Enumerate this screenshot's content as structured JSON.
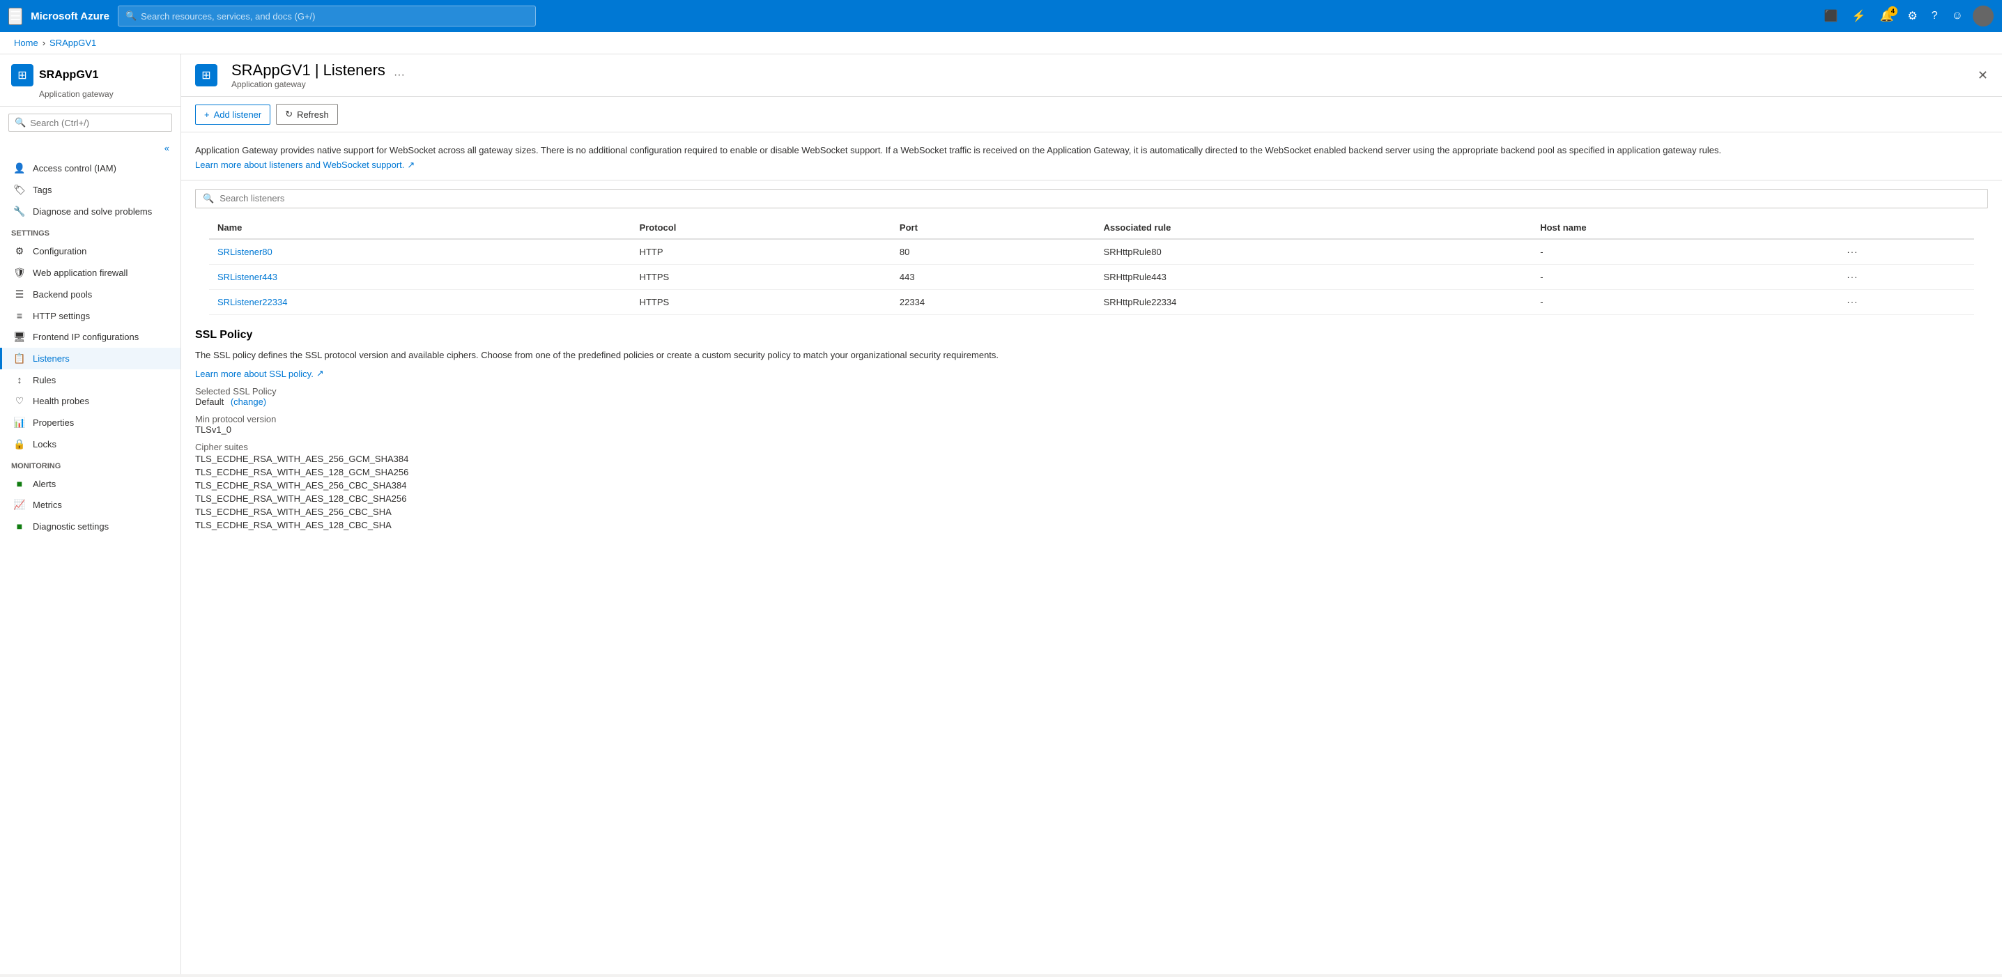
{
  "topbar": {
    "menu_label": "☰",
    "logo": "Microsoft Azure",
    "search_placeholder": "Search resources, services, and docs (G+/)",
    "notification_count": "4",
    "icons": {
      "email": "✉",
      "upload": "⬆",
      "bell": "🔔",
      "settings": "⚙",
      "help": "?",
      "feedback": "☺"
    }
  },
  "breadcrumb": {
    "home": "Home",
    "resource": "SRAppGV1"
  },
  "sidebar": {
    "resource_name": "SRAppGV1 | Listeners",
    "resource_type": "Application gateway",
    "search_placeholder": "Search (Ctrl+/)",
    "collapse_label": "«",
    "sections": {
      "settings_label": "Settings",
      "monitoring_label": "Monitoring"
    },
    "items": [
      {
        "id": "access-control",
        "label": "Access control (IAM)",
        "icon": "👤"
      },
      {
        "id": "tags",
        "label": "Tags",
        "icon": "🏷"
      },
      {
        "id": "diagnose",
        "label": "Diagnose and solve problems",
        "icon": "🔧"
      },
      {
        "id": "configuration",
        "label": "Configuration",
        "icon": "⚙"
      },
      {
        "id": "web-app-firewall",
        "label": "Web application firewall",
        "icon": "🛡"
      },
      {
        "id": "backend-pools",
        "label": "Backend pools",
        "icon": "☰"
      },
      {
        "id": "http-settings",
        "label": "HTTP settings",
        "icon": "≡"
      },
      {
        "id": "frontend-ip",
        "label": "Frontend IP configurations",
        "icon": "🖥"
      },
      {
        "id": "listeners",
        "label": "Listeners",
        "icon": "📋",
        "active": true
      },
      {
        "id": "rules",
        "label": "Rules",
        "icon": "↕"
      },
      {
        "id": "health-probes",
        "label": "Health probes",
        "icon": "♡"
      },
      {
        "id": "properties",
        "label": "Properties",
        "icon": "📊"
      },
      {
        "id": "locks",
        "label": "Locks",
        "icon": "🔒"
      },
      {
        "id": "alerts",
        "label": "Alerts",
        "icon": "🟩"
      },
      {
        "id": "metrics",
        "label": "Metrics",
        "icon": "📈"
      },
      {
        "id": "diagnostic-settings",
        "label": "Diagnostic settings",
        "icon": "🟩"
      }
    ]
  },
  "content": {
    "title": "SRAppGV1 | Listeners",
    "subtitle": "Application gateway",
    "toolbar": {
      "add_listener": "Add listener",
      "refresh": "Refresh"
    },
    "info_text": "Application Gateway provides native support for WebSocket across all gateway sizes. There is no additional configuration required to enable or disable WebSocket support. If a WebSocket traffic is received on the Application Gateway, it is automatically directed to the WebSocket enabled backend server using the appropriate backend pool as specified in application gateway rules.",
    "info_link": "Learn more about listeners and WebSocket support.",
    "search_placeholder": "Search listeners",
    "table": {
      "columns": [
        "Name",
        "Protocol",
        "Port",
        "Associated rule",
        "Host name"
      ],
      "rows": [
        {
          "name": "SRListener80",
          "protocol": "HTTP",
          "port": "80",
          "rule": "SRHttpRule80",
          "hostname": "-"
        },
        {
          "name": "SRListener443",
          "protocol": "HTTPS",
          "port": "443",
          "rule": "SRHttpRule443",
          "hostname": "-"
        },
        {
          "name": "SRListener22334",
          "protocol": "HTTPS",
          "port": "22334",
          "rule": "SRHttpRule22334",
          "hostname": "-"
        }
      ]
    },
    "ssl_policy": {
      "title": "SSL Policy",
      "description": "The SSL policy defines the SSL protocol version and available ciphers. Choose from one of the predefined policies or create a custom security policy to match your organizational security requirements.",
      "learn_more_link": "Learn more about SSL policy.",
      "selected_label": "Selected SSL Policy",
      "selected_value": "Default",
      "change_label": "(change)",
      "min_protocol_label": "Min protocol version",
      "min_protocol_value": "TLSv1_0",
      "cipher_label": "Cipher suites",
      "ciphers": [
        "TLS_ECDHE_RSA_WITH_AES_256_GCM_SHA384",
        "TLS_ECDHE_RSA_WITH_AES_128_GCM_SHA256",
        "TLS_ECDHE_RSA_WITH_AES_256_CBC_SHA384",
        "TLS_ECDHE_RSA_WITH_AES_128_CBC_SHA256",
        "TLS_ECDHE_RSA_WITH_AES_256_CBC_SHA",
        "TLS_ECDHE_RSA_WITH_AES_128_CBC_SHA"
      ]
    }
  }
}
